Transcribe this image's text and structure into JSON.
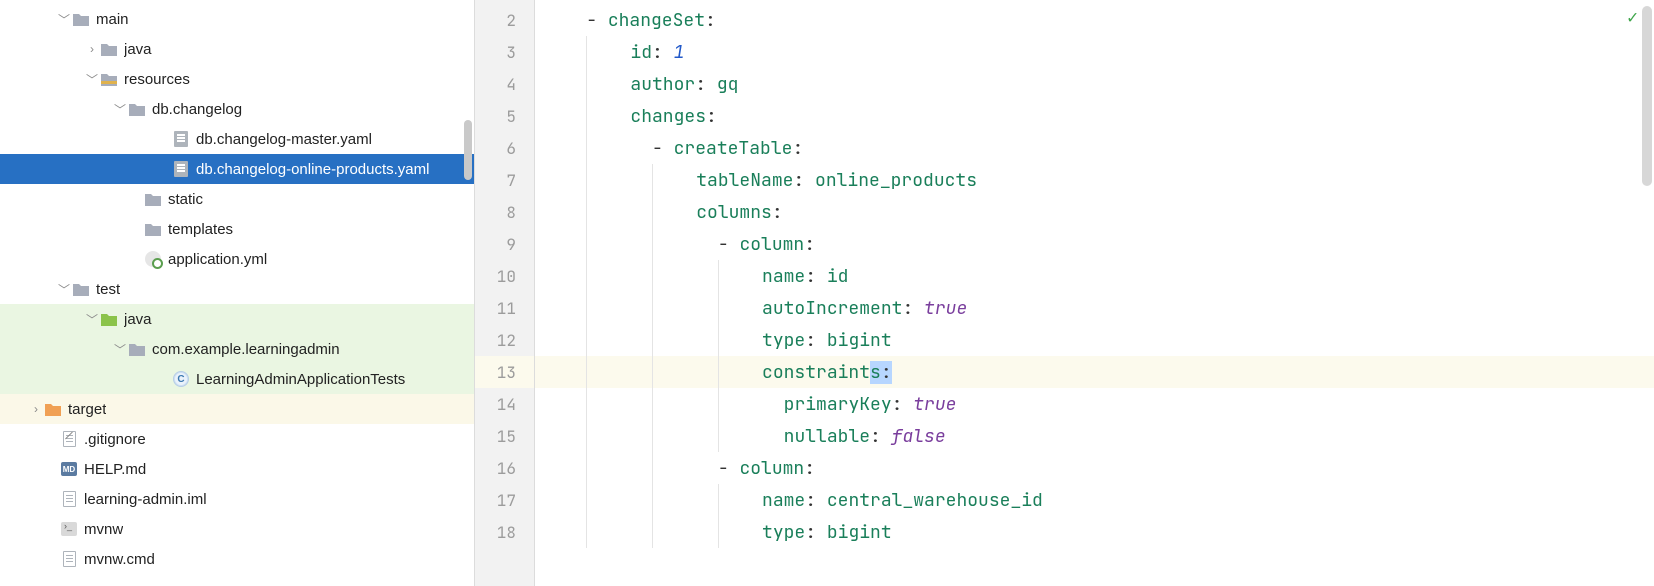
{
  "tree": {
    "main": "main",
    "java": "java",
    "resources": "resources",
    "dbchangelog": "db.changelog",
    "master": "db.changelog-master.yaml",
    "online": "db.changelog-online-products.yaml",
    "static": "static",
    "templates": "templates",
    "appyml": "application.yml",
    "test": "test",
    "testjava": "java",
    "pkg": "com.example.learningadmin",
    "tests": "LearningAdminApplicationTests",
    "target": "target",
    "gitignore": ".gitignore",
    "help": "HELP.md",
    "iml": "learning-admin.iml",
    "mvnw": "mvnw",
    "mvnwcmd": "mvnw.cmd"
  },
  "gutter": {
    "start": 2,
    "end": 18,
    "current": 13
  },
  "code": {
    "l2": {
      "key": "changeSet"
    },
    "l3": {
      "key": "id",
      "val": "1"
    },
    "l4": {
      "key": "author",
      "val": "gq"
    },
    "l5": {
      "key": "changes"
    },
    "l6": {
      "key": "createTable"
    },
    "l7": {
      "key": "tableName",
      "val": "online_products"
    },
    "l8": {
      "key": "columns"
    },
    "l9": {
      "key": "column"
    },
    "l10": {
      "key": "name",
      "val": "id"
    },
    "l11": {
      "key": "autoIncrement",
      "val": "true"
    },
    "l12": {
      "key": "type",
      "val": "bigint"
    },
    "l13": {
      "key_a": "constraint",
      "key_b": "s",
      "colon": ":"
    },
    "l14": {
      "key": "primaryKey",
      "val": "true"
    },
    "l15": {
      "key": "nullable",
      "val": "false"
    },
    "l16": {
      "key": "column"
    },
    "l17": {
      "key": "name",
      "val": "central_warehouse_id"
    },
    "l18": {
      "key": "type",
      "val": "bigint"
    }
  },
  "status": {
    "ok_icon": "✓"
  },
  "icons": {
    "md_label": "MD",
    "java_label": "C"
  }
}
